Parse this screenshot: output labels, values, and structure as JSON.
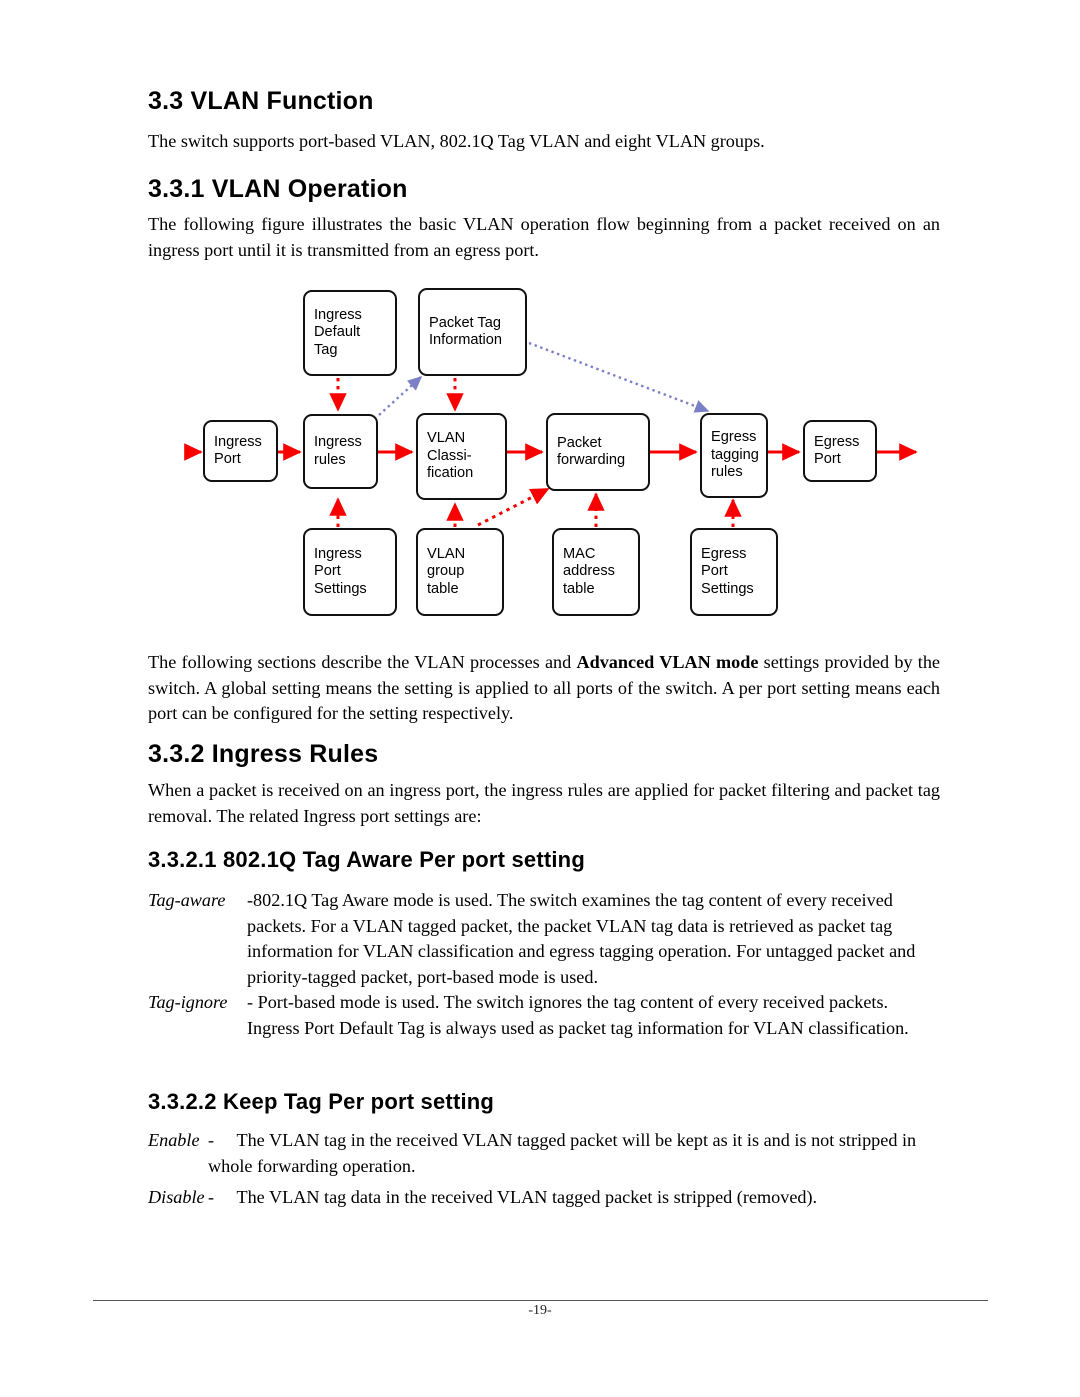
{
  "document": {
    "page_number": "-19-"
  },
  "sections": {
    "vlan_function": {
      "heading": "3.3 VLAN Function",
      "paragraph": "The switch supports port-based VLAN, 802.1Q Tag VLAN and eight VLAN groups."
    },
    "vlan_operation": {
      "heading": "3.3.1 VLAN Operation",
      "paragraph": "The following figure illustrates the basic VLAN operation flow beginning from a packet received on an ingress port until it is transmitted from an egress port.",
      "after_figure_lead": "The following sections describe the VLAN processes and ",
      "after_figure_bold": "Advanced VLAN mode",
      "after_figure_tail": " settings provided by the switch. A global setting means the setting is applied to all ports of the switch. A per port setting means each port can be configured for the setting respectively."
    },
    "ingress_rules": {
      "heading": "3.3.2 Ingress Rules",
      "paragraph": "When a packet is received on an ingress port, the ingress rules are applied for packet filtering and packet tag removal. The related Ingress port settings are:"
    },
    "tag_aware_setting": {
      "heading": "3.3.2.1 802.1Q Tag Aware Per port setting",
      "items": [
        {
          "term": "Tag-aware",
          "text": "-802.1Q Tag Aware mode is used. The switch examines the tag content of every received packets. For a VLAN tagged packet, the packet VLAN tag data is retrieved as packet tag information for VLAN classification and egress tagging operation. For untagged packet and priority-tagged packet, port-based mode is used."
        },
        {
          "term": "Tag-ignore",
          "text": "- Port-based mode is used. The switch ignores the tag content of every received packets. Ingress Port Default Tag is always used as packet tag information for VLAN classification."
        }
      ]
    },
    "keep_tag_setting": {
      "heading": "3.3.2.2 Keep Tag Per port setting",
      "items": [
        {
          "term": "Enable",
          "text": "-  The VLAN tag in the received VLAN tagged packet will be kept as it is and is not stripped in whole forwarding operation."
        },
        {
          "term": "Disable",
          "text": "-  The VLAN tag data in the received VLAN tagged packet is stripped (removed)."
        }
      ]
    }
  },
  "figure": {
    "name": "vlan-operation-flow",
    "colors": {
      "flow_arrow": "#f90000",
      "dotted_arrow": "#f90000",
      "tag_info_arrow": "#7b7fc4",
      "box_border": "#111111"
    },
    "boxes": {
      "ingress_default_tag": {
        "line1": "Ingress",
        "line2": "Default",
        "line3": "Tag"
      },
      "packet_tag_information": {
        "line1": "Packet Tag",
        "line2": "Information"
      },
      "ingress_port": {
        "line1": "Ingress",
        "line2": "Port"
      },
      "ingress_rules": {
        "line1": "Ingress",
        "line2": "rules"
      },
      "vlan_classification": {
        "line1": "VLAN",
        "line2": "Classi-",
        "line3": "fication"
      },
      "packet_forwarding": {
        "line1": "Packet",
        "line2": "forwarding"
      },
      "egress_tagging_rules": {
        "line1": "Egress",
        "line2": "tagging",
        "line3": "rules"
      },
      "egress_port": {
        "line1": "Egress",
        "line2": "Port"
      },
      "ingress_port_settings": {
        "line1": "Ingress",
        "line2": "Port",
        "line3": "Settings"
      },
      "vlan_group_table": {
        "line1": "VLAN",
        "line2": "group",
        "line3": "table"
      },
      "mac_address_table": {
        "line1": "MAC",
        "line2": "address",
        "line3": "table"
      },
      "egress_port_settings": {
        "line1": "Egress",
        "line2": "Port",
        "line3": "Settings"
      }
    }
  }
}
